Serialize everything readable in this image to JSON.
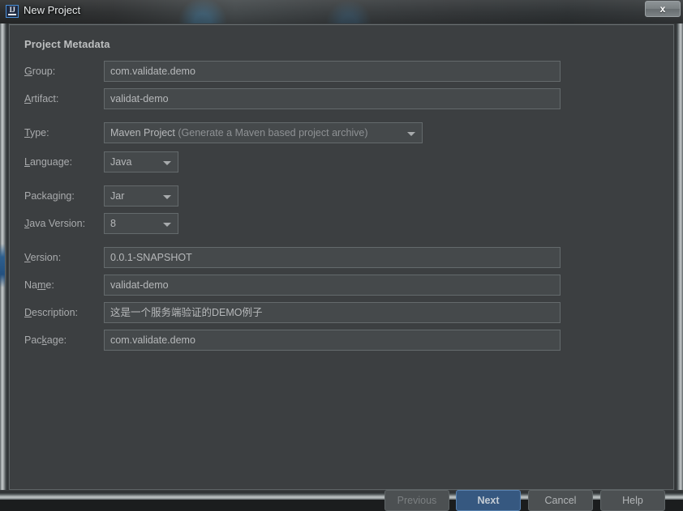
{
  "window": {
    "title": "New Project",
    "icon": "intellij-idea-icon",
    "close_label": "x"
  },
  "dialog": {
    "section_title": "Project Metadata",
    "fields": [
      {
        "id": "group",
        "label_pre": "",
        "label_mnemonic": "G",
        "label_post": "roup:",
        "label_full": "Group:",
        "kind": "text",
        "value": "com.validate.demo"
      },
      {
        "id": "artifact",
        "label_pre": "",
        "label_mnemonic": "A",
        "label_post": "rtifact:",
        "label_full": "Artifact:",
        "kind": "text",
        "value": "validat-demo"
      },
      {
        "id": "type",
        "label_pre": "",
        "label_mnemonic": "T",
        "label_post": "ype:",
        "label_full": "Type:",
        "kind": "wide-combo",
        "value": "Maven Project",
        "value_hint": "(Generate a Maven based project archive)"
      },
      {
        "id": "language",
        "label_pre": "",
        "label_mnemonic": "L",
        "label_post": "anguage:",
        "label_full": "Language:",
        "kind": "combo",
        "value": "Java"
      },
      {
        "id": "packaging",
        "label_pre": "Packa",
        "label_mnemonic": "g",
        "label_post": "ing:",
        "label_full": "Packaging:",
        "kind": "combo",
        "value": "Jar"
      },
      {
        "id": "java-version",
        "label_pre": "",
        "label_mnemonic": "J",
        "label_post": "ava Version:",
        "label_full": "Java Version:",
        "kind": "combo",
        "value": "8"
      },
      {
        "id": "version",
        "label_pre": "",
        "label_mnemonic": "V",
        "label_post": "ersion:",
        "label_full": "Version:",
        "kind": "text",
        "value": "0.0.1-SNAPSHOT"
      },
      {
        "id": "name",
        "label_pre": "Na",
        "label_mnemonic": "m",
        "label_post": "e:",
        "label_full": "Name:",
        "kind": "text",
        "value": "validat-demo"
      },
      {
        "id": "description",
        "label_pre": "",
        "label_mnemonic": "D",
        "label_post": "escription:",
        "label_full": "Description:",
        "kind": "text",
        "value": "这是一个服务端验证的DEMO例子"
      },
      {
        "id": "package",
        "label_pre": "Pac",
        "label_mnemonic": "k",
        "label_post": "age:",
        "label_full": "Package:",
        "kind": "text",
        "value": "com.validate.demo"
      }
    ],
    "buttons": [
      {
        "id": "previous",
        "label": "Previous",
        "state": "disabled"
      },
      {
        "id": "next",
        "label": "Next",
        "state": "default"
      },
      {
        "id": "cancel",
        "label": "Cancel",
        "state": "normal"
      },
      {
        "id": "help",
        "label": "Help",
        "state": "normal"
      }
    ]
  },
  "colors": {
    "panel_bg": "#3c3f41",
    "field_bg": "#45494b",
    "field_border": "#646a6c",
    "text": "#b6b8ba",
    "label": "#a9abad",
    "accent_blue": "#365880",
    "accent_blue_border": "#5781b0"
  }
}
